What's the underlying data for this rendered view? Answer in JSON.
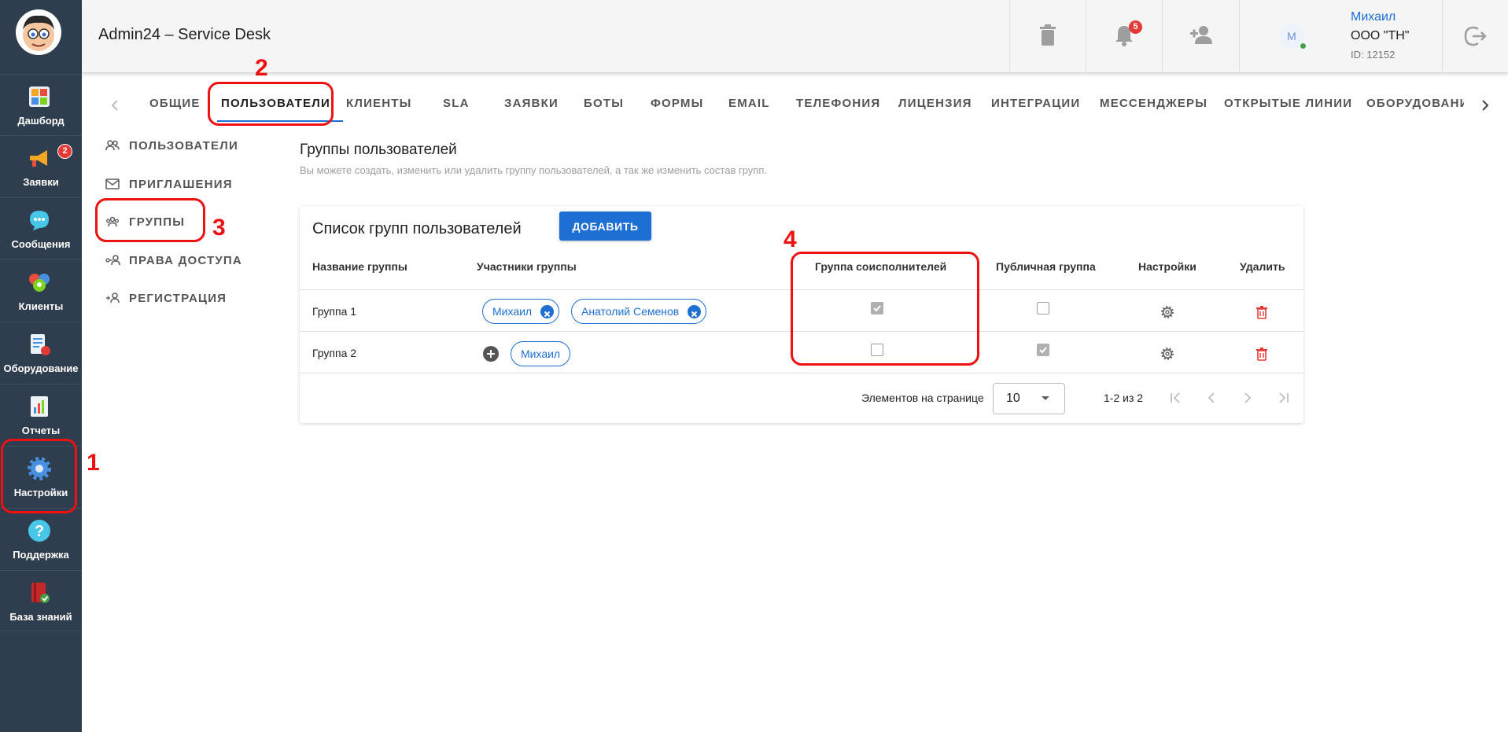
{
  "leftnav": {
    "items": [
      {
        "label": "Дашборд"
      },
      {
        "label": "Заявки",
        "badge": "2"
      },
      {
        "label": "Сообщения"
      },
      {
        "label": "Клиенты"
      },
      {
        "label": "Оборудование"
      },
      {
        "label": "Отчеты"
      },
      {
        "label": "Настройки"
      },
      {
        "label": "Поддержка"
      },
      {
        "label": "База знаний"
      }
    ]
  },
  "header": {
    "title": "Admin24 – Service Desk",
    "notifications_count": "5",
    "user": {
      "avatar_letter": "M",
      "name": "Михаил",
      "org": "ООО \"ТН\"",
      "id": "ID: 12152"
    }
  },
  "tabs": [
    "ОБЩИЕ",
    "ПОЛЬЗОВАТЕЛИ",
    "КЛИЕНТЫ",
    "SLA",
    "ЗАЯВКИ",
    "БОТЫ",
    "ФОРМЫ",
    "EMAIL",
    "ТЕЛЕФОНИЯ",
    "ЛИЦЕНЗИЯ",
    "ИНТЕГРАЦИИ",
    "МЕССЕНДЖЕРЫ",
    "ОТКРЫТЫЕ ЛИНИИ",
    "ОБОРУДОВАНИЕ"
  ],
  "active_tab": "ПОЛЬЗОВАТЕЛИ",
  "subnav": [
    "ПОЛЬЗОВАТЕЛИ",
    "ПРИГЛАШЕНИЯ",
    "ГРУППЫ",
    "ПРАВА ДОСТУПА",
    "РЕГИСТРАЦИЯ"
  ],
  "page": {
    "title": "Группы пользователей",
    "subtitle": "Вы можете создать, изменить или удалить группу пользователей, а так же изменить состав групп."
  },
  "card": {
    "title": "Список групп пользователей",
    "add_label": "ДОБАВИТЬ",
    "columns": [
      "Название группы",
      "Участники группы",
      "Группа соисполнителей",
      "Публичная группа",
      "Настройки",
      "Удалить"
    ],
    "rows": [
      {
        "name": "Группа 1",
        "members": [
          "Михаил",
          "Анатолий Семенов"
        ],
        "co_executors": true,
        "public": false
      },
      {
        "name": "Группа 2",
        "members": [
          "Михаил"
        ],
        "co_executors": false,
        "public": true
      }
    ],
    "pager": {
      "label": "Элементов на странице",
      "per_page": "10",
      "range": "1-2 из 2"
    }
  },
  "annotations": [
    "1",
    "2",
    "3",
    "4"
  ],
  "colors": {
    "accent": "#1e6fd3",
    "sidebar": "#2f3e4e",
    "annotation": "#ee1111",
    "danger": "#e53935"
  }
}
